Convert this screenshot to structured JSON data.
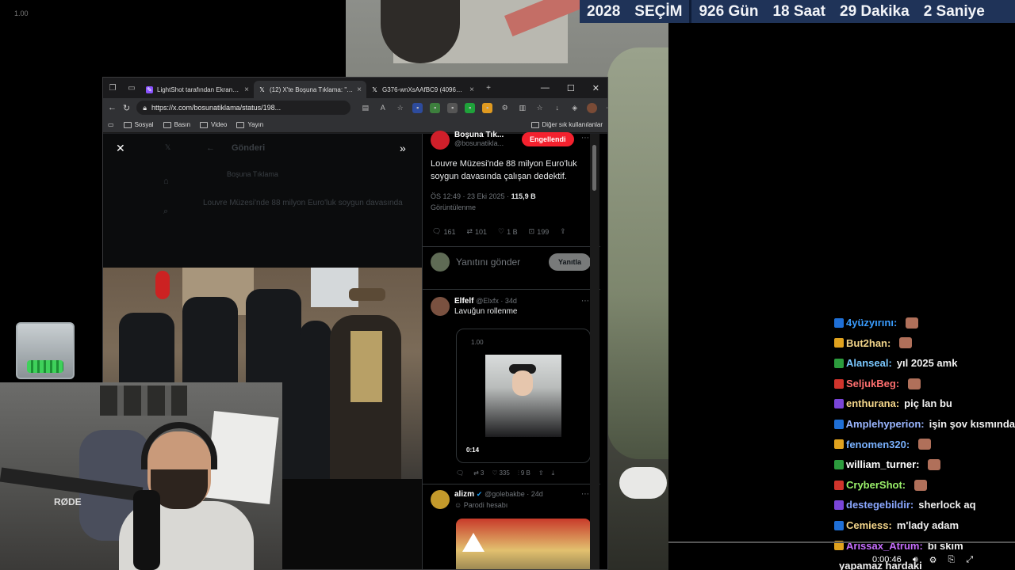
{
  "corner_label": "1.00",
  "countdown": {
    "year": "2028",
    "election": "SEÇİM",
    "days": "926 Gün",
    "hours": "18 Saat",
    "minutes": "29 Dakika",
    "seconds": "2 Saniye"
  },
  "browser": {
    "tabs": [
      {
        "title": "LightShot tarafından Ekran Gö",
        "close": "×"
      },
      {
        "title": "(12) X'te Boşuna Tıklama: \"Lou",
        "close": "×"
      },
      {
        "title": "G376-wnXsAAfBC9 (4096×27",
        "close": "×"
      }
    ],
    "new_tab": "+",
    "url": "https://x.com/bosunatiklama/status/198...",
    "bookmarks": [
      "Sosyal",
      "Basın",
      "Video",
      "Yayın"
    ],
    "other_bookmarks": "Diğer sık kullanılanlar"
  },
  "ghost_page": {
    "header": "Gönderi",
    "author": "Boşuna Tıklama",
    "text": "Louvre Müzesi'nde 88 milyon Euro'luk soygun davasında"
  },
  "tweet": {
    "author_name": "Boşuna Tık...",
    "handle": "@bosunatiklа...",
    "blocked_label": "Engellendi",
    "text": "Louvre Müzesi'nde 88 milyon Euro'luk soygun davasında çalışan dedektif.",
    "time": "ÖS 12:49 · 23 Eki 2025 · ",
    "views": "115,9 B",
    "views_label": "Görüntülenme",
    "replies": "161",
    "reposts": "101",
    "likes": "1 B",
    "bookmarks": "199",
    "reply_placeholder": "Yanıtını gönder",
    "reply_button": "Yanıtla"
  },
  "posts": [
    {
      "name": "Elfelf",
      "handle": "@Elxfx · 34d",
      "text": "Lavuğun rollenme",
      "embed_label": "1.00",
      "duration": "0:14",
      "replies": "",
      "reposts": "3",
      "likes": "335",
      "views": "9 B"
    },
    {
      "name": "alizm",
      "handle": "@golebakbe · 24d",
      "label": "Parodi hesabı"
    }
  ],
  "chat": [
    {
      "user": "4yüzyırını:",
      "text": "",
      "color": "#3a9dff"
    },
    {
      "user": "But2han:",
      "text": "",
      "color": "#f3d58a"
    },
    {
      "user": "Alanseal:",
      "text": "yıl 2025 amk",
      "color": "#7ac8ff"
    },
    {
      "user": "SeljukBeg:",
      "text": "",
      "color": "#ff6f6f"
    },
    {
      "user": "enthurana:",
      "text": "piç lan bu",
      "color": "#f3d58a"
    },
    {
      "user": "Amplehyperion:",
      "text": "işin şov kısmında",
      "color": "#9ab6ff"
    },
    {
      "user": "fenomen320:",
      "text": "",
      "color": "#7ab2ff"
    },
    {
      "user": "william_turner:",
      "text": "",
      "color": "#ffffff"
    },
    {
      "user": "CryberShot:",
      "text": "",
      "color": "#9cf26b"
    },
    {
      "user": "destegebildir:",
      "text": "sherlock aq",
      "color": "#8aa7ff"
    },
    {
      "user": "Cemiess:",
      "text": "m'lady adam",
      "color": "#f3d58a"
    },
    {
      "user": "Arissax_Atrum:",
      "text": "bi skim",
      "color": "#c86fff"
    },
    {
      "user": "",
      "text": "yapamaz hardaki",
      "color": "#ffffff"
    }
  ],
  "player": {
    "time": "0:00:46"
  }
}
